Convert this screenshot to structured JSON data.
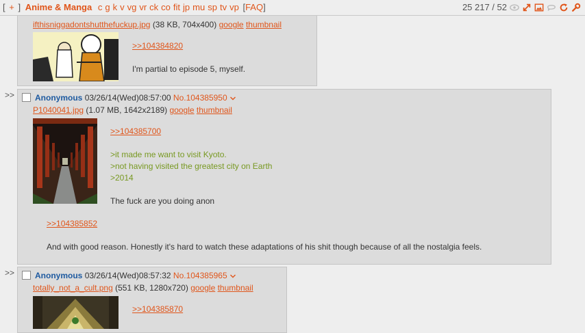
{
  "topbar": {
    "open_bracket": "[",
    "plus": "+",
    "close_bracket": "]",
    "board_title": "Anime & Manga",
    "board_links": [
      "c",
      "g",
      "k",
      "v",
      "vg",
      "vr",
      "ck",
      "co",
      "fit",
      "jp",
      "mu",
      "sp",
      "tv",
      "vp"
    ],
    "faq_open": "[",
    "faq": "FAQ",
    "faq_close": "]",
    "stats": "25 217 / 52",
    "icons": [
      "eye-icon",
      "expand-icon",
      "image-icon",
      "chat-bubble-icon",
      "refresh-icon",
      "wrench-icon"
    ],
    "accent": "#e0551a"
  },
  "posts": [
    {
      "filename": "ifthisniggadontshutthefuckup.jpg",
      "filemeta": "(38 KB, 704x400)",
      "google": "google",
      "thumbnail": "thumbnail",
      "quotelink": ">>104384820",
      "body": "I'm partial to episode 5, myself."
    },
    {
      "arrows": ">>",
      "name": "Anonymous",
      "datetime": "03/26/14(Wed)08:57:00",
      "postno": "No.104385950",
      "filename": "P1040041.jpg",
      "filemeta": "(1.07 MB, 1642x2189)",
      "google": "google",
      "thumbnail": "thumbnail",
      "quotelink": ">>104385700",
      "greentext": [
        ">it made me want to visit Kyoto.",
        ">not having visited the greatest city on Earth",
        ">2014"
      ],
      "body1": "The fuck are you doing anon",
      "quotelink2": ">>104385852",
      "body2": "And with good reason. Honestly it's hard to watch these adaptations of his shit though because of all the nostalgia feels."
    },
    {
      "arrows": ">>",
      "name": "Anonymous",
      "datetime": "03/26/14(Wed)08:57:32",
      "postno": "No.104385965",
      "filename": "totally_not_a_cult.png",
      "filemeta": "(551 KB, 1280x720)",
      "google": "google",
      "thumbnail": "thumbnail",
      "quotelink": ">>104385870"
    }
  ]
}
